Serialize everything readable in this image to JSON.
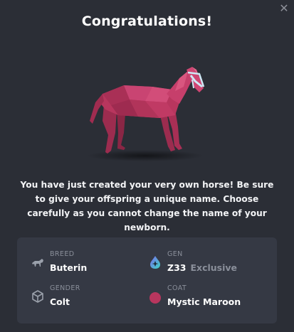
{
  "modal": {
    "title": "Congratulations!",
    "close_label": "✕",
    "message": "You have just created your very own horse! Be sure to give your offspring a unique name. Choose carefully as you cannot change the name of your newborn."
  },
  "horse": {
    "coat_color": "#b8365e",
    "bridle_color": "#cfe8f5"
  },
  "info": {
    "breed": {
      "label": "BREED",
      "value": "Buterin",
      "icon": "horse-icon"
    },
    "gen": {
      "label": "GEN",
      "value": "Z33",
      "extra": "Exclusive",
      "icon": "gen-drop-icon"
    },
    "gender": {
      "label": "GENDER",
      "value": "Colt",
      "icon": "cube-icon"
    },
    "coat": {
      "label": "COAT",
      "value": "Mystic Maroon",
      "swatch": "#b8365e"
    }
  }
}
